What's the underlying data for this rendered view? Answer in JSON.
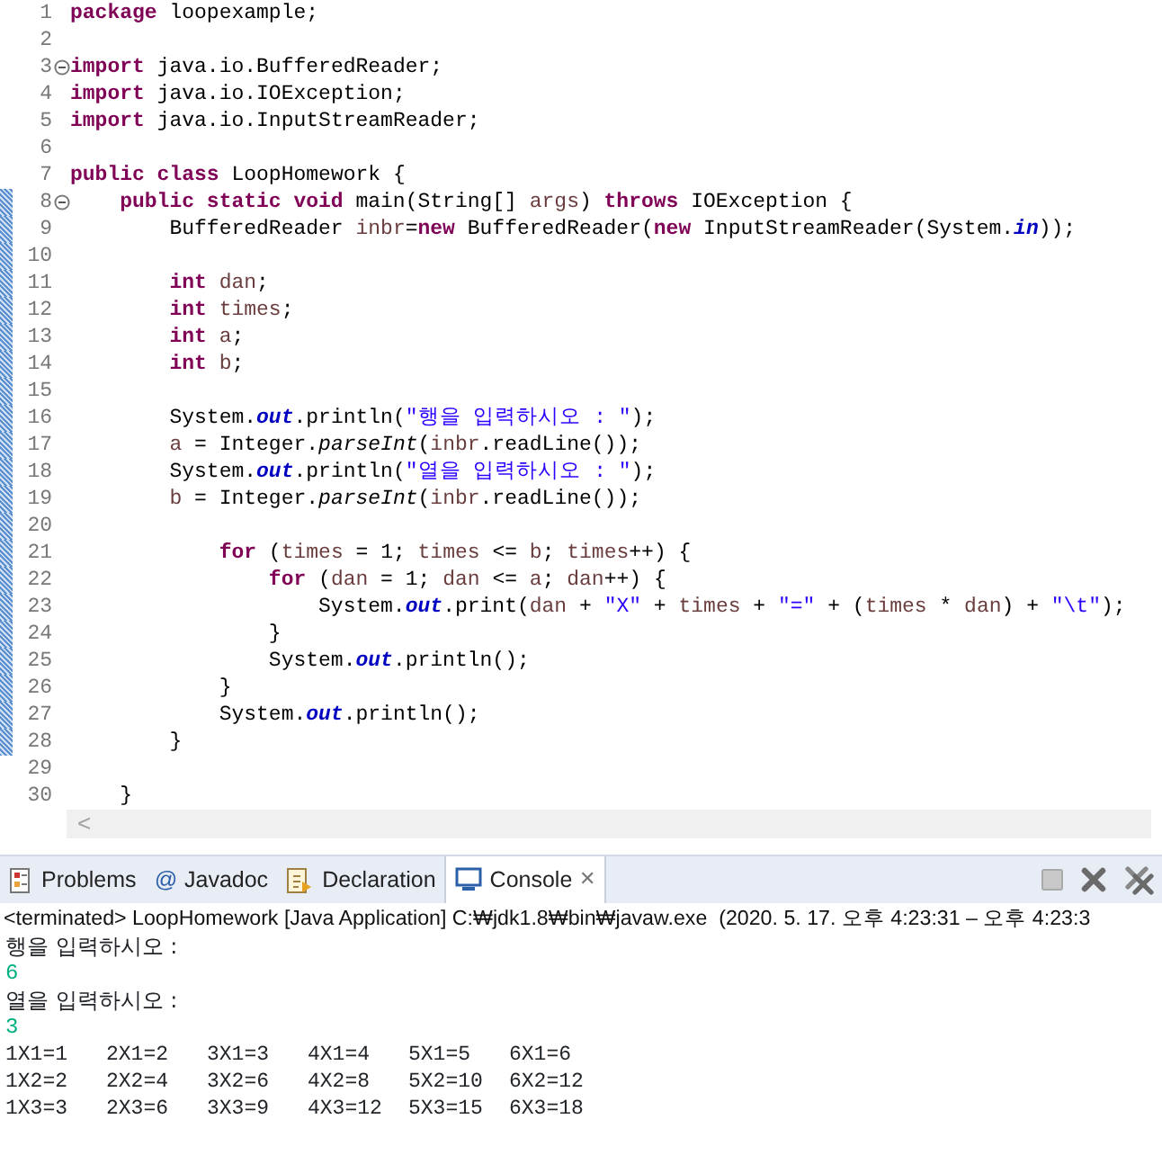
{
  "editor": {
    "lines": [
      {
        "n": "1",
        "changed": false,
        "fold": false,
        "tokens": [
          {
            "kind": "keyword",
            "text": "package"
          },
          {
            "kind": "plain",
            "text": " loopexample;"
          }
        ]
      },
      {
        "n": "2",
        "changed": false,
        "fold": false
      },
      {
        "n": "3",
        "changed": false,
        "fold": true,
        "tokens": [
          {
            "kind": "keyword",
            "text": "import"
          },
          {
            "kind": "plain",
            "text": " java.io.BufferedReader;"
          }
        ]
      },
      {
        "n": "4",
        "changed": false,
        "fold": false,
        "tokens": [
          {
            "kind": "keyword",
            "text": "import"
          },
          {
            "kind": "plain",
            "text": " java.io.IOException;"
          }
        ]
      },
      {
        "n": "5",
        "changed": false,
        "fold": false,
        "tokens": [
          {
            "kind": "keyword",
            "text": "import"
          },
          {
            "kind": "plain",
            "text": " java.io.InputStreamReader;"
          }
        ]
      },
      {
        "n": "6",
        "changed": false,
        "fold": false
      },
      {
        "n": "7",
        "changed": false,
        "fold": false,
        "tokens": [
          {
            "kind": "keyword",
            "text": "public class"
          },
          {
            "kind": "plain",
            "text": " LoopHomework {"
          }
        ]
      },
      {
        "n": "8",
        "changed": true,
        "fold": true,
        "tokens": [
          {
            "kind": "keyword",
            "text": "    public static void"
          },
          {
            "kind": "plain",
            "text": " main(String[] "
          },
          {
            "kind": "local",
            "text": "args"
          },
          {
            "kind": "plain",
            "text": ") "
          },
          {
            "kind": "keyword",
            "text": "throws"
          },
          {
            "kind": "plain",
            "text": " IOException {"
          }
        ]
      },
      {
        "n": "9",
        "changed": true,
        "fold": false,
        "tokens": [
          {
            "kind": "plain",
            "text": "        BufferedReader "
          },
          {
            "kind": "local",
            "text": "inbr"
          },
          {
            "kind": "plain",
            "text": "="
          },
          {
            "kind": "keyword",
            "text": "new"
          },
          {
            "kind": "plain",
            "text": " BufferedReader("
          },
          {
            "kind": "keyword",
            "text": "new"
          },
          {
            "kind": "plain",
            "text": " InputStreamReader(System."
          },
          {
            "kind": "field",
            "text": "in"
          },
          {
            "kind": "plain",
            "text": "));"
          }
        ]
      },
      {
        "n": "10",
        "changed": true,
        "fold": false
      },
      {
        "n": "11",
        "changed": true,
        "fold": false,
        "tokens": [
          {
            "kind": "keyword",
            "text": "        int"
          },
          {
            "kind": "local",
            "text": " dan"
          },
          {
            "kind": "plain",
            "text": ";"
          }
        ]
      },
      {
        "n": "12",
        "changed": true,
        "fold": false,
        "tokens": [
          {
            "kind": "keyword",
            "text": "        int"
          },
          {
            "kind": "local",
            "text": " times"
          },
          {
            "kind": "plain",
            "text": ";"
          }
        ]
      },
      {
        "n": "13",
        "changed": true,
        "fold": false,
        "tokens": [
          {
            "kind": "keyword",
            "text": "        int"
          },
          {
            "kind": "local",
            "text": " a"
          },
          {
            "kind": "plain",
            "text": ";"
          }
        ]
      },
      {
        "n": "14",
        "changed": true,
        "fold": false,
        "tokens": [
          {
            "kind": "keyword",
            "text": "        int"
          },
          {
            "kind": "local",
            "text": " b"
          },
          {
            "kind": "plain",
            "text": ";"
          }
        ]
      },
      {
        "n": "15",
        "changed": true,
        "fold": false
      },
      {
        "n": "16",
        "changed": true,
        "fold": false,
        "tokens": [
          {
            "kind": "plain",
            "text": "        System."
          },
          {
            "kind": "field",
            "text": "out"
          },
          {
            "kind": "plain",
            "text": ".println("
          },
          {
            "kind": "string",
            "text": "\"행을 입력하시오 : \""
          },
          {
            "kind": "plain",
            "text": ");"
          }
        ]
      },
      {
        "n": "17",
        "changed": true,
        "fold": false,
        "tokens": [
          {
            "kind": "local",
            "text": "        a"
          },
          {
            "kind": "plain",
            "text": " = Integer."
          },
          {
            "kind": "static",
            "text": "parseInt"
          },
          {
            "kind": "plain",
            "text": "("
          },
          {
            "kind": "local",
            "text": "inbr"
          },
          {
            "kind": "plain",
            "text": ".readLine());"
          }
        ]
      },
      {
        "n": "18",
        "changed": true,
        "fold": false,
        "tokens": [
          {
            "kind": "plain",
            "text": "        System."
          },
          {
            "kind": "field",
            "text": "out"
          },
          {
            "kind": "plain",
            "text": ".println("
          },
          {
            "kind": "string",
            "text": "\"열을 입력하시오 : \""
          },
          {
            "kind": "plain",
            "text": ");"
          }
        ]
      },
      {
        "n": "19",
        "changed": true,
        "fold": false,
        "tokens": [
          {
            "kind": "local",
            "text": "        b"
          },
          {
            "kind": "plain",
            "text": " = Integer."
          },
          {
            "kind": "static",
            "text": "parseInt"
          },
          {
            "kind": "plain",
            "text": "("
          },
          {
            "kind": "local",
            "text": "inbr"
          },
          {
            "kind": "plain",
            "text": ".readLine());"
          }
        ]
      },
      {
        "n": "20",
        "changed": true,
        "fold": false
      },
      {
        "n": "21",
        "changed": true,
        "fold": false,
        "tokens": [
          {
            "kind": "keyword",
            "text": "            for"
          },
          {
            "kind": "plain",
            "text": " ("
          },
          {
            "kind": "local",
            "text": "times"
          },
          {
            "kind": "plain",
            "text": " = 1; "
          },
          {
            "kind": "local",
            "text": "times"
          },
          {
            "kind": "plain",
            "text": " <= "
          },
          {
            "kind": "local",
            "text": "b"
          },
          {
            "kind": "plain",
            "text": "; "
          },
          {
            "kind": "local",
            "text": "times"
          },
          {
            "kind": "plain",
            "text": "++) {"
          }
        ]
      },
      {
        "n": "22",
        "changed": true,
        "fold": false,
        "tokens": [
          {
            "kind": "keyword",
            "text": "                for"
          },
          {
            "kind": "plain",
            "text": " ("
          },
          {
            "kind": "local",
            "text": "dan"
          },
          {
            "kind": "plain",
            "text": " = 1; "
          },
          {
            "kind": "local",
            "text": "dan"
          },
          {
            "kind": "plain",
            "text": " <= "
          },
          {
            "kind": "local",
            "text": "a"
          },
          {
            "kind": "plain",
            "text": "; "
          },
          {
            "kind": "local",
            "text": "dan"
          },
          {
            "kind": "plain",
            "text": "++) {"
          }
        ]
      },
      {
        "n": "23",
        "changed": true,
        "fold": false,
        "tokens": [
          {
            "kind": "plain",
            "text": "                    System."
          },
          {
            "kind": "field",
            "text": "out"
          },
          {
            "kind": "plain",
            "text": ".print("
          },
          {
            "kind": "local",
            "text": "dan"
          },
          {
            "kind": "plain",
            "text": " + "
          },
          {
            "kind": "string",
            "text": "\"X\""
          },
          {
            "kind": "plain",
            "text": " + "
          },
          {
            "kind": "local",
            "text": "times"
          },
          {
            "kind": "plain",
            "text": " + "
          },
          {
            "kind": "string",
            "text": "\"=\""
          },
          {
            "kind": "plain",
            "text": " + ("
          },
          {
            "kind": "local",
            "text": "times"
          },
          {
            "kind": "plain",
            "text": " * "
          },
          {
            "kind": "local",
            "text": "dan"
          },
          {
            "kind": "plain",
            "text": ") + "
          },
          {
            "kind": "string",
            "text": "\"\\t\""
          },
          {
            "kind": "plain",
            "text": ");"
          }
        ]
      },
      {
        "n": "24",
        "changed": true,
        "fold": false,
        "tokens": [
          {
            "kind": "plain",
            "text": "                }"
          }
        ]
      },
      {
        "n": "25",
        "changed": true,
        "fold": false,
        "tokens": [
          {
            "kind": "plain",
            "text": "                System."
          },
          {
            "kind": "field",
            "text": "out"
          },
          {
            "kind": "plain",
            "text": ".println();"
          }
        ]
      },
      {
        "n": "26",
        "changed": true,
        "fold": false,
        "tokens": [
          {
            "kind": "plain",
            "text": "            }"
          }
        ]
      },
      {
        "n": "27",
        "changed": true,
        "fold": false,
        "tokens": [
          {
            "kind": "plain",
            "text": "            System."
          },
          {
            "kind": "field",
            "text": "out"
          },
          {
            "kind": "plain",
            "text": ".println();"
          }
        ]
      },
      {
        "n": "28",
        "changed": true,
        "fold": false,
        "tokens": [
          {
            "kind": "plain",
            "text": "        }"
          }
        ]
      },
      {
        "n": "29",
        "changed": false,
        "fold": false
      },
      {
        "n": "30",
        "changed": false,
        "fold": false,
        "tokens": [
          {
            "kind": "plain",
            "text": "    }"
          }
        ]
      }
    ],
    "scroll_arrow": "<"
  },
  "panel": {
    "tabs": [
      {
        "label": "Problems",
        "selected": false
      },
      {
        "label": "Javadoc",
        "icon_text": "@",
        "selected": false
      },
      {
        "label": "Declaration",
        "selected": false
      },
      {
        "label": "Console",
        "selected": true,
        "close": "✕"
      }
    ]
  },
  "console": {
    "header": "<terminated> LoopHomework [Java Application] C:₩jdk1.8₩bin₩javaw.exe  (2020. 5. 17. 오후 4:23:31 – 오후 4:23:3",
    "lines": [
      {
        "kind": "output",
        "text": "행을 입력하시오 : "
      },
      {
        "kind": "input",
        "text": "6"
      },
      {
        "kind": "output",
        "text": "열을 입력하시오 : "
      },
      {
        "kind": "input",
        "text": "3"
      },
      {
        "kind": "table",
        "cells": [
          "1X1=1",
          "2X1=2",
          "3X1=3",
          "4X1=4",
          "5X1=5",
          "6X1=6"
        ]
      },
      {
        "kind": "table",
        "cells": [
          "1X2=2",
          "2X2=4",
          "3X2=6",
          "4X2=8",
          "5X2=10",
          "6X2=12"
        ]
      },
      {
        "kind": "table",
        "cells": [
          "1X3=3",
          "2X3=6",
          "3X3=9",
          "4X3=12",
          "5X3=15",
          "6X3=18"
        ]
      }
    ]
  }
}
